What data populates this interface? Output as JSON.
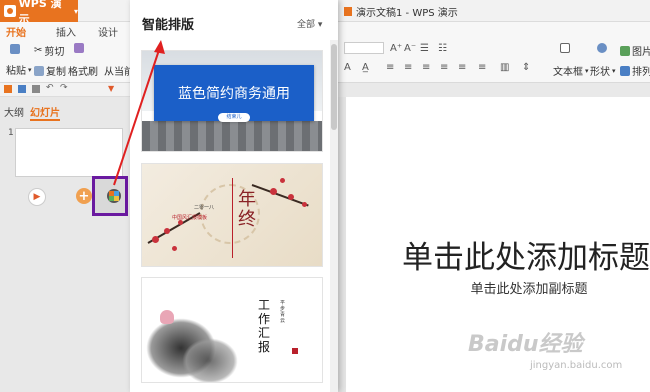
{
  "app": {
    "menu_label": "WPS 演示",
    "doc_title": "演示文稿1 - WPS 演示"
  },
  "ribbon": {
    "tabs": [
      "开始",
      "插入",
      "设计"
    ],
    "paste": "粘贴",
    "cut": "剪切",
    "copy": "复制",
    "format_painter": "格式刷",
    "from_current": "从当前",
    "textbox": "文本框",
    "shape": "形状",
    "picture": "图片",
    "arrange": "排列"
  },
  "left_panel": {
    "tab_outline": "大纲",
    "tab_slides": "幻灯片",
    "slide_number": "1"
  },
  "smart_panel": {
    "title": "智能排版",
    "filter": "全部",
    "templates": [
      {
        "title": "蓝色简约商务通用",
        "button": "结束儿"
      },
      {
        "big_text": "年终",
        "line1": "二零一八",
        "line2": "中国风汇报模板"
      },
      {
        "vertical_text": "工作汇报",
        "side_text": "平步青云"
      }
    ]
  },
  "slide": {
    "title": "单击此处添加标题",
    "subtitle": "单击此处添加副标题"
  },
  "watermark": {
    "text": "Baidu经验",
    "url": "jingyan.baidu.com"
  },
  "colors": {
    "accent": "#e8731f",
    "highlight_box": "#6a1aa0",
    "arrow": "#e02020",
    "template_blue": "#1b5fc8"
  },
  "icons": [
    "wps-logo-icon",
    "paste-icon",
    "cut-icon",
    "copy-icon",
    "format-painter-icon",
    "play-icon",
    "add-icon",
    "smart-layout-icon",
    "textbox-icon",
    "shape-icon",
    "picture-icon",
    "arrange-icon"
  ]
}
